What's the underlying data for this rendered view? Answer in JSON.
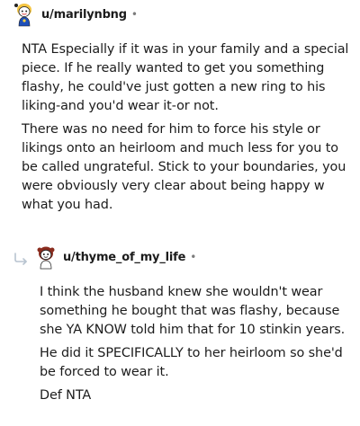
{
  "comments": [
    {
      "username": "u/marilynbng",
      "dot": "•",
      "paragraphs": [
        "NTA Especially if it was in your family and a special piece. If he really wanted to get you something flashy, he could've just gotten a new ring to his liking-and you'd wear it-or not.",
        "There was no need for him to force his style or likings onto an heirloom and much less for you to be called ungrateful. Stick to your boundaries, you were obviously very clear about being happy w what you had."
      ],
      "avatar_icon": "avatar-snoo-icon"
    },
    {
      "username": "u/thyme_of_my_life",
      "dot": "•",
      "paragraphs": [
        "I think the husband knew she wouldn't wear something he bought that was flashy, because she YA KNOW told him that for 10 stinkin years.",
        "He did it SPECIFICALLY to her heirloom so she'd be forced to wear it.",
        "Def NTA"
      ],
      "avatar_icon": "avatar-snoo-icon",
      "reply_icon": "reply-arrow-icon"
    }
  ],
  "colors": {
    "text": "#1c1c1c",
    "muted": "#7c7c7c",
    "reply_arrow": "#b8c4d0"
  }
}
